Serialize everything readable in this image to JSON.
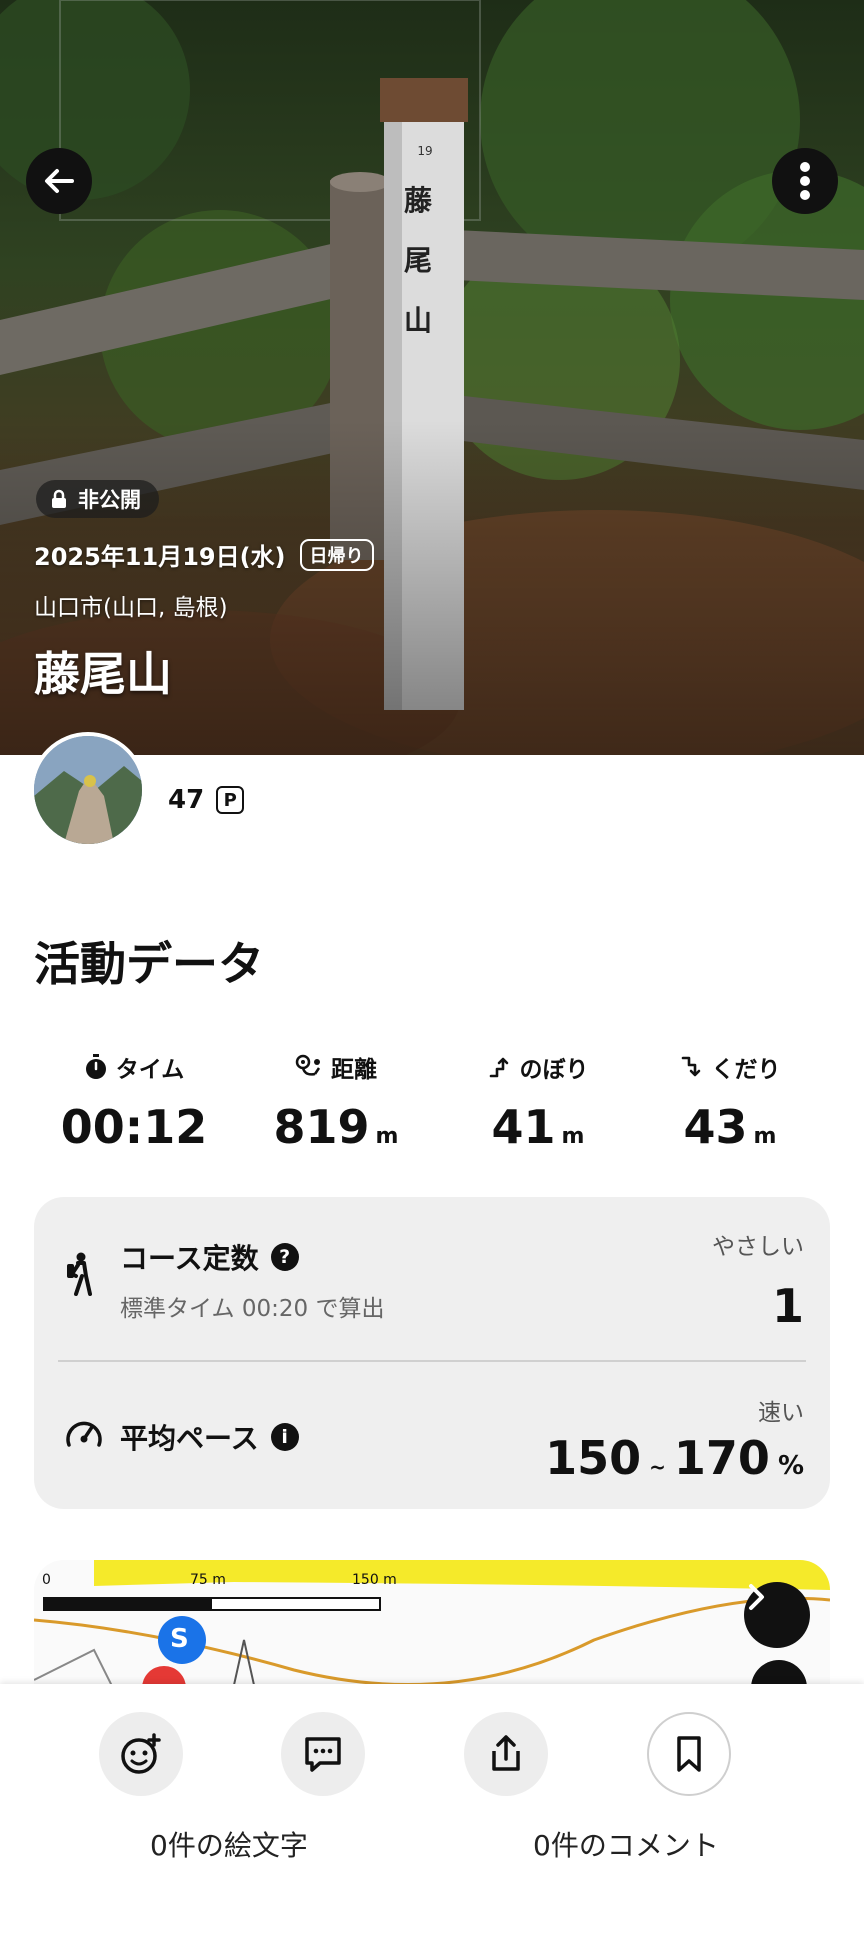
{
  "hero": {
    "privacy_label": "非公開",
    "date": "2025年11月19日(水)",
    "trip_type": "日帰り",
    "region": "山口市(山口, 島根)",
    "title": "藤尾山",
    "signpost_text": "藤 尾 山",
    "signpost_number": "19"
  },
  "user": {
    "points": "47",
    "points_icon": "P"
  },
  "activity": {
    "title": "活動データ",
    "stats": [
      {
        "label": "タイム",
        "value": "00:12",
        "unit": ""
      },
      {
        "label": "距離",
        "value": "819",
        "unit": "m"
      },
      {
        "label": "のぼり",
        "value": "41",
        "unit": "m"
      },
      {
        "label": "くだり",
        "value": "43",
        "unit": "m"
      }
    ],
    "course": {
      "title": "コース定数",
      "help_icon": "?",
      "subtitle": "標準タイム 00:20 で算出",
      "difficulty_label": "やさしい",
      "value": "1"
    },
    "pace": {
      "title": "平均ペース",
      "info_icon": "i",
      "speed_label": "速い",
      "min": "150",
      "sep": "~",
      "max": "170",
      "unit": "%"
    }
  },
  "map": {
    "scale_labels": [
      "0",
      "75 m",
      "150 m"
    ],
    "start_marker": "S"
  },
  "bottom": {
    "emoji_count": "0件の絵文字",
    "comment_count": "0件のコメント"
  },
  "colors": {
    "accent_blue": "#1a73e8",
    "map_yellow": "#f5ea2a",
    "route_orange": "#d99a2b"
  }
}
